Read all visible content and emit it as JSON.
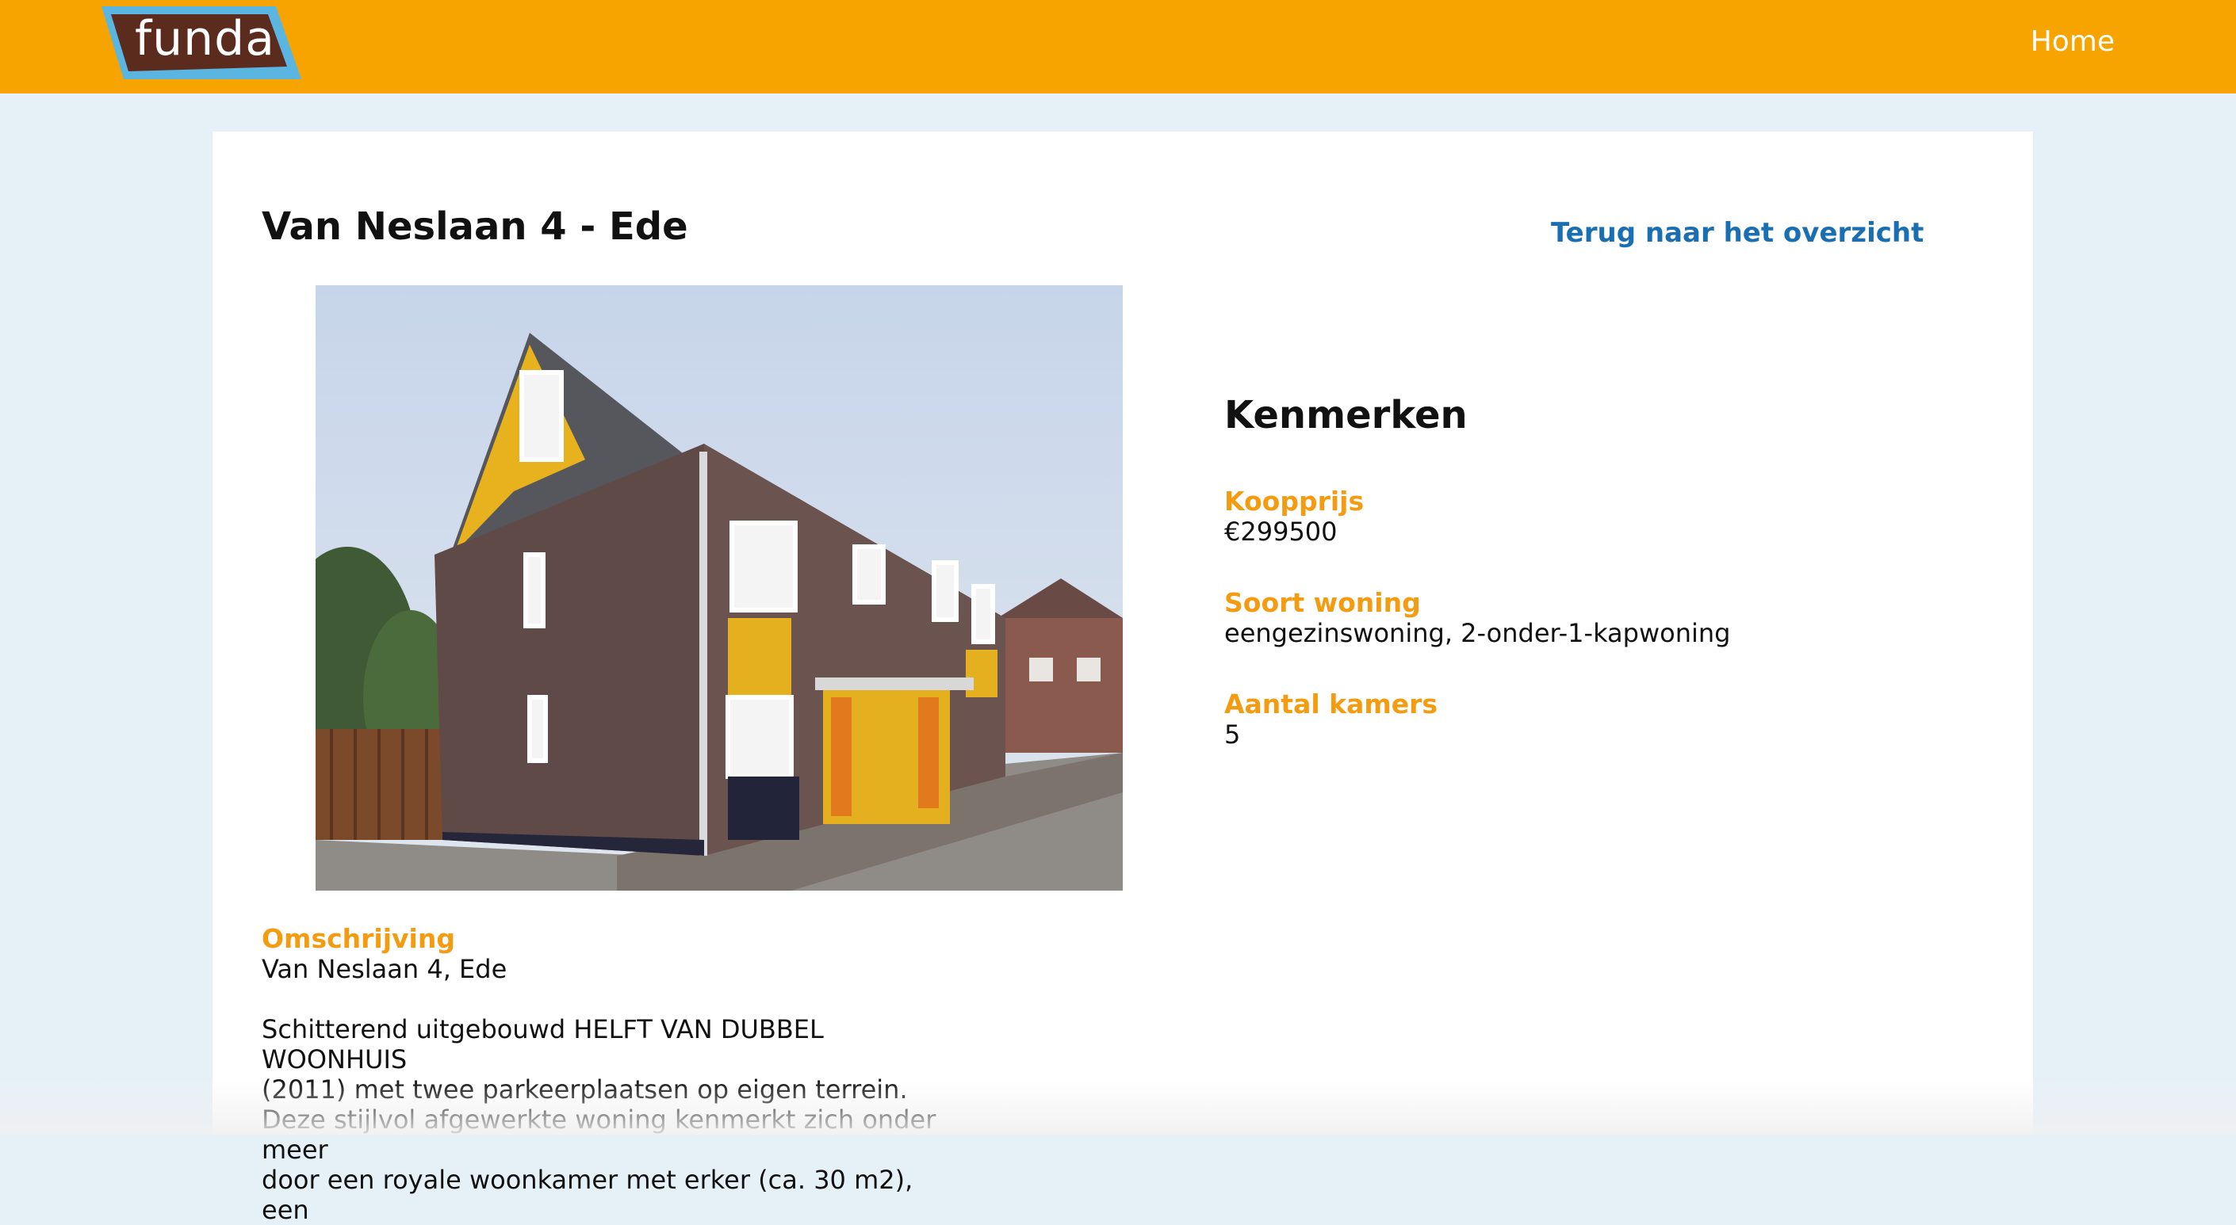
{
  "header": {
    "logo_text": "funda",
    "nav_home": "Home"
  },
  "listing": {
    "title": "Van Neslaan 4 - Ede",
    "back_link": "Terug naar het overzicht",
    "photo_alt": "Van Neslaan 4 - Ede"
  },
  "features": {
    "heading": "Kenmerken",
    "items": [
      {
        "label": "Koopprijs",
        "value": "€299500"
      },
      {
        "label": "Soort woning",
        "value": "eengezinswoning, 2-onder-1-kapwoning"
      },
      {
        "label": "Aantal kamers",
        "value": "5"
      }
    ]
  },
  "description": {
    "label": "Omschrijving",
    "address": "Van Neslaan 4, Ede",
    "body": "Schitterend uitgebouwd HELFT VAN DUBBEL WOONHUIS\n(2011) met twee parkeerplaatsen op eigen terrein.\nDeze stijlvol afgewerkte woning kenmerkt zich onder meer\ndoor een royale woonkamer met erker (ca. 30 m2), een"
  },
  "colors": {
    "header_bg": "#f7a400",
    "page_bg": "#e6f1f7",
    "accent_label": "#f39c12",
    "link": "#1a6fb3",
    "logo_bg": "#5b2b1e",
    "logo_border": "#5ab6e0"
  }
}
